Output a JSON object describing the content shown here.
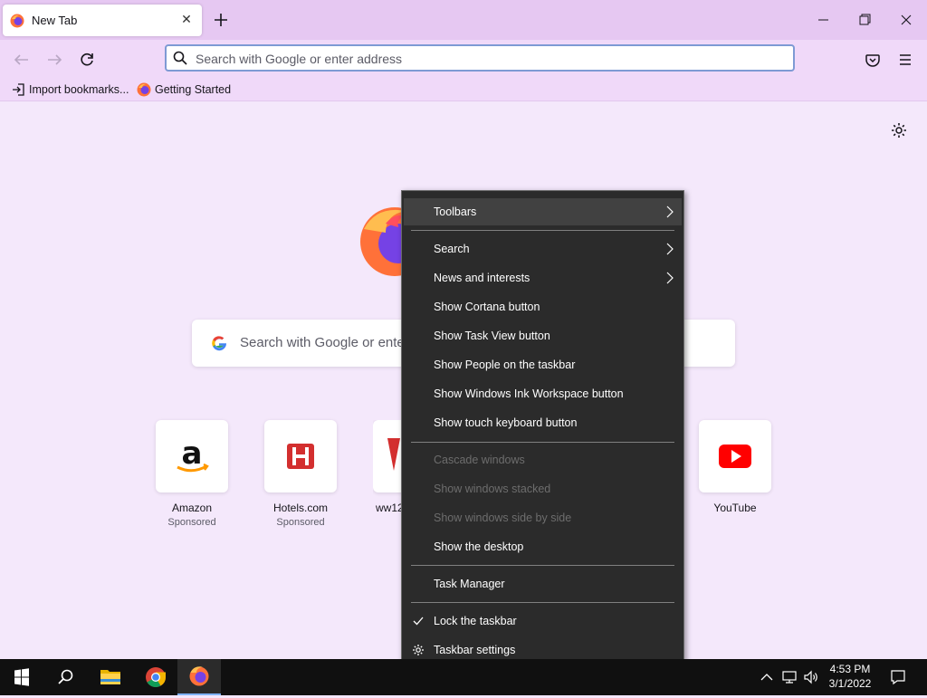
{
  "browser": {
    "tab_title": "New Tab",
    "url_placeholder": "Search with Google or enter address",
    "bookmarks": [
      "Import bookmarks...",
      "Getting Started"
    ]
  },
  "newtab": {
    "search_placeholder": "Search with Google or ente",
    "shortcuts": [
      {
        "name": "Amazon",
        "sponsored": "Sponsored"
      },
      {
        "name": "Hotels.com",
        "sponsored": "Sponsored"
      },
      {
        "name": "ww12"
      },
      {
        "name": "YouTube"
      }
    ]
  },
  "context_menu": {
    "items": [
      {
        "label": "Toolbars"
      },
      {
        "label": "Search"
      },
      {
        "label": "News and interests"
      },
      {
        "label": "Show Cortana button"
      },
      {
        "label": "Show Task View button"
      },
      {
        "label": "Show People on the taskbar"
      },
      {
        "label": "Show Windows Ink Workspace button"
      },
      {
        "label": "Show touch keyboard button"
      },
      {
        "label": "Cascade windows"
      },
      {
        "label": "Show windows stacked"
      },
      {
        "label": "Show windows side by side"
      },
      {
        "label": "Show the desktop"
      },
      {
        "label": "Task Manager"
      },
      {
        "label": "Lock the taskbar"
      },
      {
        "label": "Taskbar settings"
      }
    ]
  },
  "taskbar": {
    "time": "4:53 PM",
    "date": "3/1/2022"
  },
  "colors": {
    "titlebar": "#e6c8f2",
    "toolbar": "#f0d9f9",
    "content_bg": "#f4e8fb",
    "menu_bg": "#2b2b2b",
    "taskbar": "#101010"
  }
}
